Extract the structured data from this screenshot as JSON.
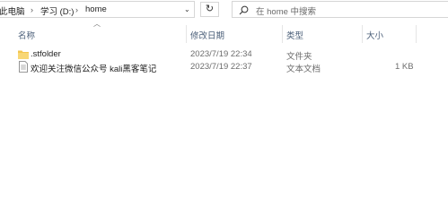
{
  "address": {
    "crumbs": [
      "此电脑",
      "学习 (D:)",
      "home"
    ],
    "separator": "›",
    "dropdown": "⌄",
    "refresh": "↻"
  },
  "search": {
    "placeholder": "在 home 中搜索"
  },
  "columns": {
    "name": "名称",
    "modified": "修改日期",
    "type": "类型",
    "size": "大小"
  },
  "files": [
    {
      "name": ".stfolder",
      "modified": "2023/7/19 22:34",
      "type": "文件夹",
      "size": ""
    },
    {
      "name": "欢迎关注微信公众号 kali黑客笔记",
      "modified": "2023/7/19 22:37",
      "type": "文本文档",
      "size": "1 KB"
    }
  ],
  "colors": {
    "folder": "#f3c64f",
    "header_text": "#4c607a"
  }
}
